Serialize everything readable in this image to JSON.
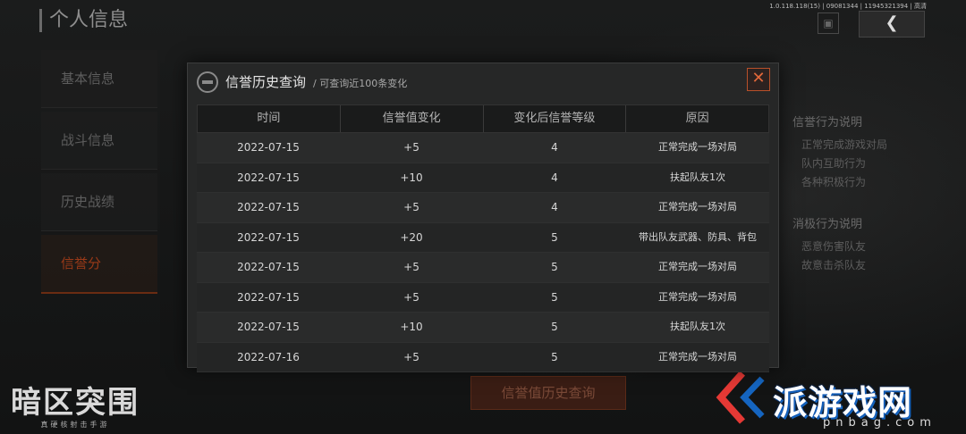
{
  "app": {
    "page_title": "个人信息",
    "version": "1.0.118.118(15) | 09081344 | 11945321394 | 高清"
  },
  "left_nav": {
    "items": [
      {
        "label": "基本信息"
      },
      {
        "label": "战斗信息"
      },
      {
        "label": "历史战绩"
      },
      {
        "label": "信誉分"
      }
    ],
    "active_index": 3
  },
  "right_panel": {
    "positive_heading": "信誉行为说明",
    "positive_lines": [
      "正常完成游戏对局",
      "队内互助行为",
      "各种积极行为"
    ],
    "negative_heading": "消极行为说明",
    "negative_lines": [
      "恶意伤害队友",
      "故意击杀队友"
    ]
  },
  "query_button_label": "信誉值历史查询",
  "modal": {
    "title": "信誉历史查询",
    "subtitle": "/ 可查询近100条变化",
    "close_icon": "✕",
    "columns": [
      "时间",
      "信誉值变化",
      "变化后信誉等级",
      "原因"
    ],
    "rows": [
      {
        "time": "2022-07-15",
        "change": "+5",
        "level": "4",
        "reason": "正常完成一场对局"
      },
      {
        "time": "2022-07-15",
        "change": "+10",
        "level": "4",
        "reason": "扶起队友1次"
      },
      {
        "time": "2022-07-15",
        "change": "+5",
        "level": "4",
        "reason": "正常完成一场对局"
      },
      {
        "time": "2022-07-15",
        "change": "+20",
        "level": "5",
        "reason": "带出队友武器、防具、背包"
      },
      {
        "time": "2022-07-15",
        "change": "+5",
        "level": "5",
        "reason": "正常完成一场对局"
      },
      {
        "time": "2022-07-15",
        "change": "+5",
        "level": "5",
        "reason": "正常完成一场对局"
      },
      {
        "time": "2022-07-15",
        "change": "+10",
        "level": "5",
        "reason": "扶起队友1次"
      },
      {
        "time": "2022-07-16",
        "change": "+5",
        "level": "5",
        "reason": "正常完成一场对局"
      }
    ]
  },
  "logos": {
    "game_name": "暗区突围",
    "game_tagline": "真硬核射击手游",
    "watermark_brand": "派游戏网",
    "watermark_site": "pnbag.com"
  },
  "icons": {
    "back": "arrow-left-icon",
    "top_box": "square-icon",
    "modal": "credit-badge-icon",
    "close": "close-icon"
  },
  "colors": {
    "accent": "#e2683a",
    "active_nav": "#9a3a18",
    "watermark": "#1565c0"
  }
}
